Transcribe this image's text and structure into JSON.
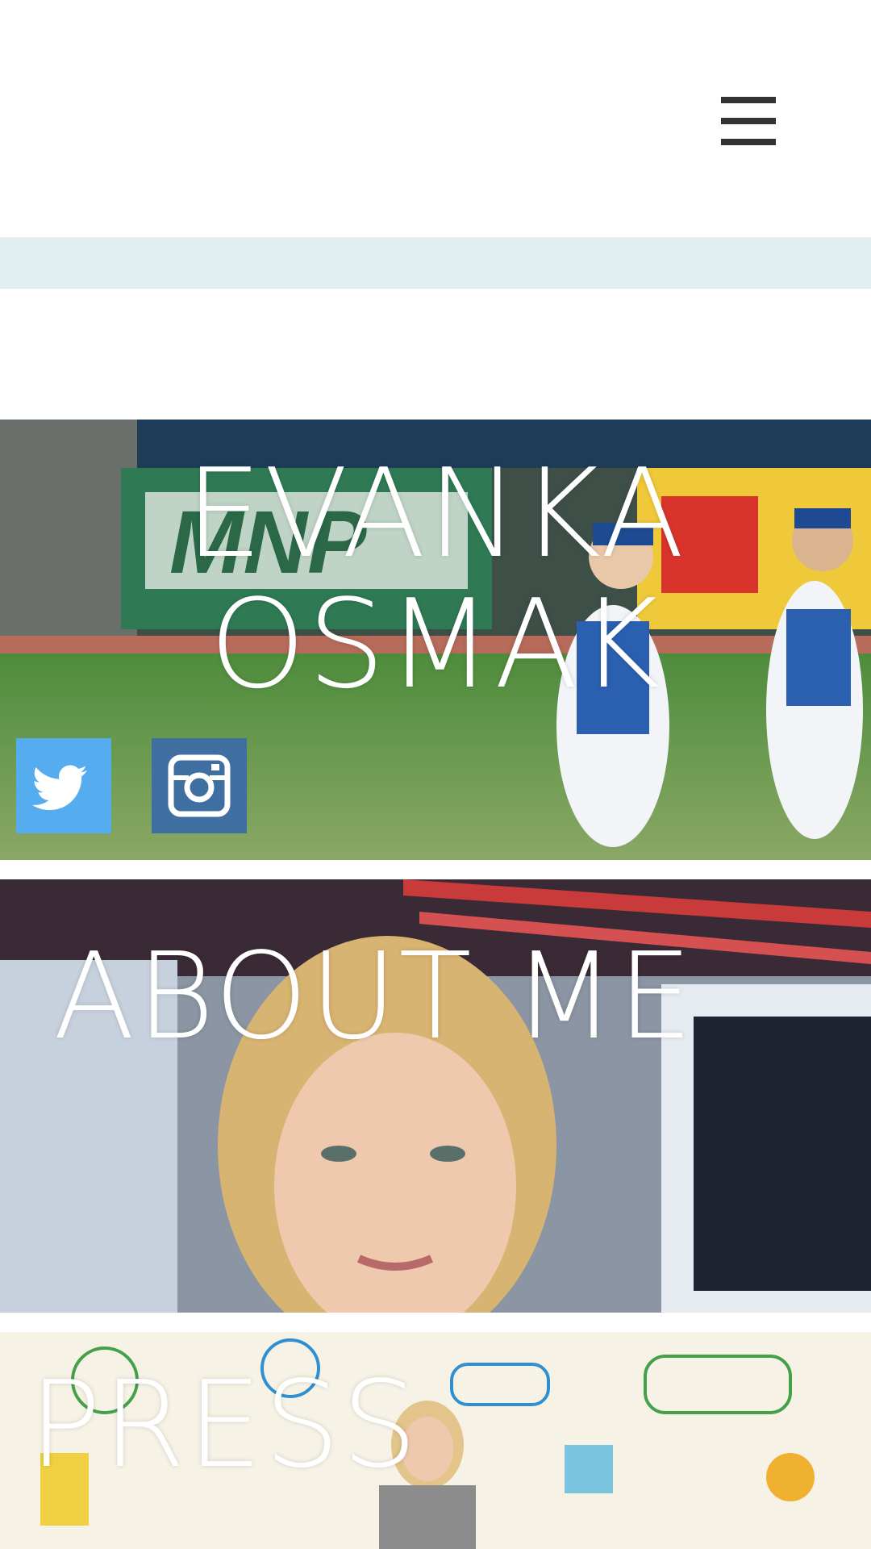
{
  "header": {
    "menu_icon": "hamburger-menu-icon"
  },
  "hero": {
    "title_line1": "EVANKA",
    "title_line2": "OSMAK",
    "background": "baseball-field-players-photo",
    "social": [
      {
        "name": "twitter",
        "icon": "twitter-bird-icon",
        "color": "#55acee"
      },
      {
        "name": "instagram",
        "icon": "instagram-camera-icon",
        "color": "#3f6fa0"
      }
    ]
  },
  "about": {
    "title": "ABOUT ME",
    "background": "tv-studio-selfie-photo"
  },
  "press": {
    "title": "PRESS",
    "background": "illustrated-mural-photo"
  },
  "colors": {
    "strip": "#e2eff1",
    "menu_icon": "#333333"
  }
}
